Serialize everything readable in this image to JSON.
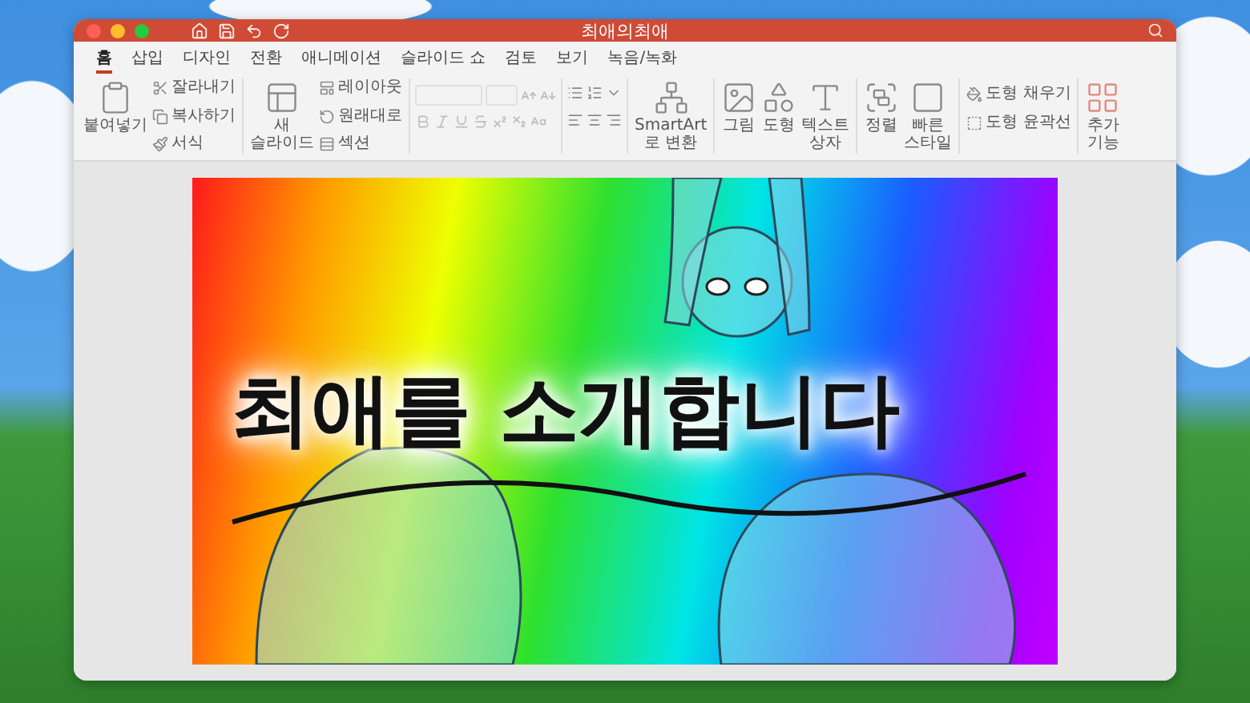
{
  "window": {
    "title": "최애의최애"
  },
  "tabs": [
    {
      "label": "홈",
      "selected": true
    },
    {
      "label": "삽입",
      "selected": false
    },
    {
      "label": "디자인",
      "selected": false
    },
    {
      "label": "전환",
      "selected": false
    },
    {
      "label": "애니메이션",
      "selected": false
    },
    {
      "label": "슬라이드 쇼",
      "selected": false
    },
    {
      "label": "검토",
      "selected": false
    },
    {
      "label": "보기",
      "selected": false
    },
    {
      "label": "녹음/녹화",
      "selected": false
    }
  ],
  "ribbon": [
    {
      "kind": "stack",
      "big": {
        "kind": "paste",
        "lines": [
          "붙여넣기"
        ]
      },
      "small": [
        {
          "kind": "cut",
          "label": "잘라내기"
        },
        {
          "kind": "copy",
          "label": "복사하기"
        },
        {
          "kind": "painter",
          "label": "서식"
        }
      ]
    },
    {
      "kind": "stack",
      "big": {
        "kind": "new-slide",
        "lines": [
          "새",
          "슬라이드"
        ]
      },
      "small": [
        {
          "kind": "layout",
          "label": "레이아웃"
        },
        {
          "kind": "reset",
          "label": "원래대로"
        },
        {
          "kind": "section",
          "label": "섹션"
        }
      ]
    },
    {
      "kind": "font",
      "disabled": true
    },
    {
      "kind": "paragraph",
      "disabled": false
    },
    {
      "kind": "buttons",
      "buttons": [
        {
          "kind": "smartart",
          "lines": [
            "SmartArt",
            "로 변환"
          ]
        }
      ]
    },
    {
      "kind": "buttons",
      "buttons": [
        {
          "kind": "picture",
          "lines": [
            "그림"
          ]
        },
        {
          "kind": "shape",
          "lines": [
            "도형"
          ]
        },
        {
          "kind": "textbox",
          "lines": [
            "텍스트",
            "상자"
          ]
        }
      ]
    },
    {
      "kind": "buttons",
      "buttons": [
        {
          "kind": "arrange",
          "lines": [
            "정렬"
          ]
        },
        {
          "kind": "quick-style",
          "lines": [
            "빠른",
            "스타일"
          ]
        }
      ]
    },
    {
      "kind": "list",
      "small": [
        {
          "kind": "fill",
          "label": "도형 채우기"
        },
        {
          "kind": "outline",
          "label": "도형 윤곽선"
        }
      ]
    },
    {
      "kind": "buttons",
      "buttons": [
        {
          "kind": "addins",
          "lines": [
            "추가",
            "기능"
          ]
        }
      ]
    }
  ],
  "slide": {
    "title": "최애를 소개합니다"
  }
}
